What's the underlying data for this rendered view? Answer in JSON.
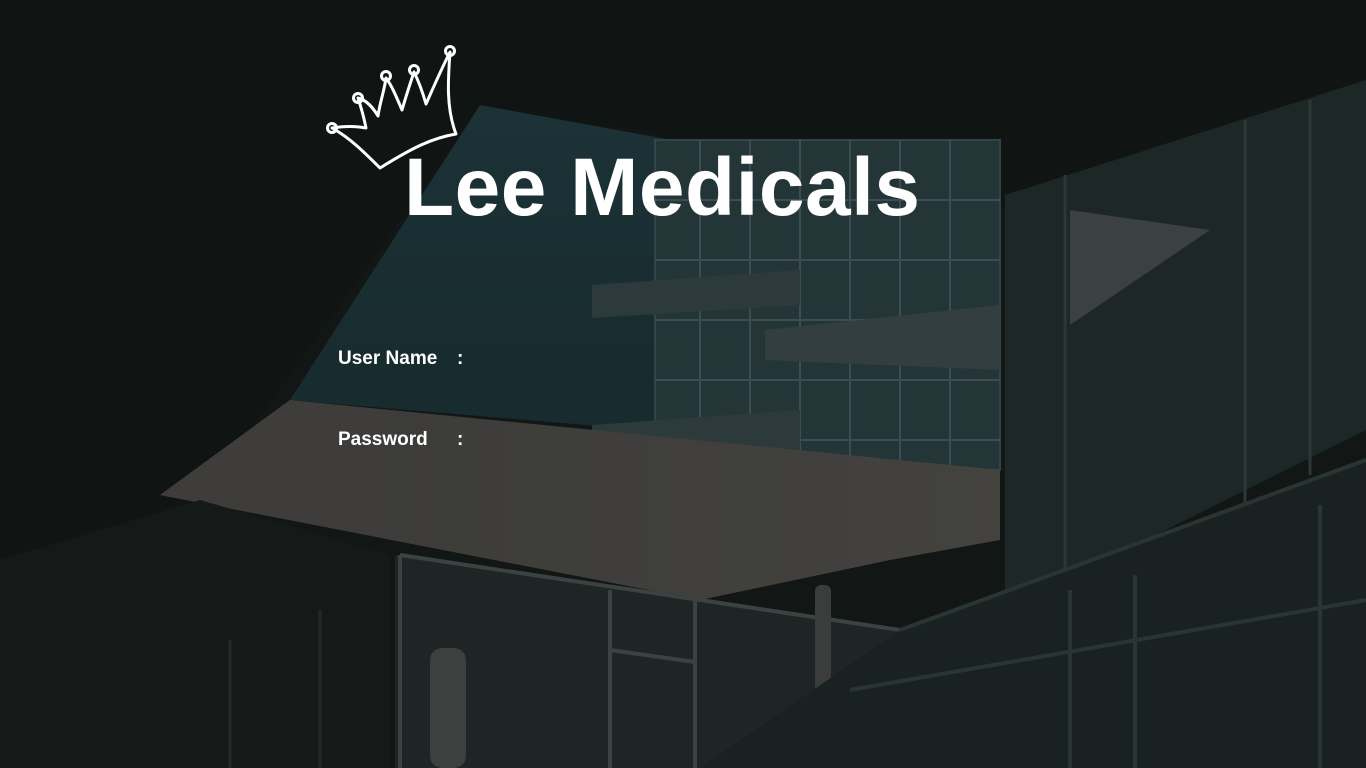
{
  "app": {
    "title": "Lee Medicals",
    "logo_icon": "crown-icon"
  },
  "login": {
    "username": {
      "label": "User Name",
      "separator": ":",
      "value": "",
      "placeholder": ""
    },
    "password": {
      "label": "Password",
      "separator": ":",
      "value": "",
      "placeholder": ""
    }
  },
  "colors": {
    "text": "#ffffff",
    "background": "#141817"
  }
}
